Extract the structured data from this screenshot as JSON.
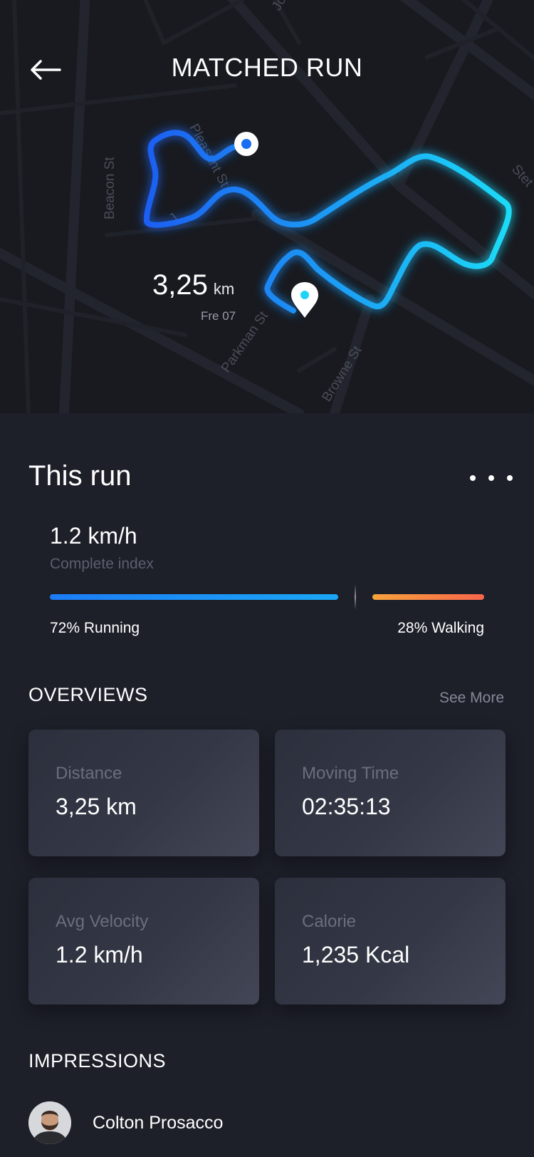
{
  "header": {
    "title": "MATCHED RUN",
    "back_icon": "arrow-left-icon"
  },
  "map": {
    "street_names": [
      "Beacon St",
      "Pleasant St",
      "Parkman St",
      "Browne St",
      "Jo",
      "Stet",
      "J"
    ],
    "route_gradient": [
      "#1a63f2",
      "#1fa0f5",
      "#1fd9f5"
    ],
    "start_marker_icon": "start-dot-icon",
    "end_marker_icon": "location-pin-icon",
    "run_distance_value": "3,25",
    "run_distance_unit": "km",
    "run_day": "Fre 07"
  },
  "run": {
    "section_title": "This run",
    "more_icon": "more-dots-icon",
    "speed_value": "1.2 km/h",
    "speed_label": "Complete index",
    "running_label": "72% Running",
    "walking_label": "28% Walking",
    "running_fraction": 0.72,
    "walking_fraction": 0.28
  },
  "overviews": {
    "title": "OVERVIEWS",
    "see_more": "See More",
    "cards": [
      {
        "label": "Distance",
        "value": "3,25 km"
      },
      {
        "label": "Moving Time",
        "value": "02:35:13"
      },
      {
        "label": "Avg Velocity",
        "value": "1.2 km/h"
      },
      {
        "label": "Calorie",
        "value": "1,235 Kcal"
      }
    ]
  },
  "impressions": {
    "title": "IMPRESSIONS",
    "person_name": "Colton Prosacco",
    "avatar_icon": "avatar"
  },
  "colors": {
    "background": "#1d1f29",
    "map_background": "#181a20",
    "running_bar": "#1c7cf6",
    "walking_bar": "#f7654b",
    "card": "#343846"
  }
}
